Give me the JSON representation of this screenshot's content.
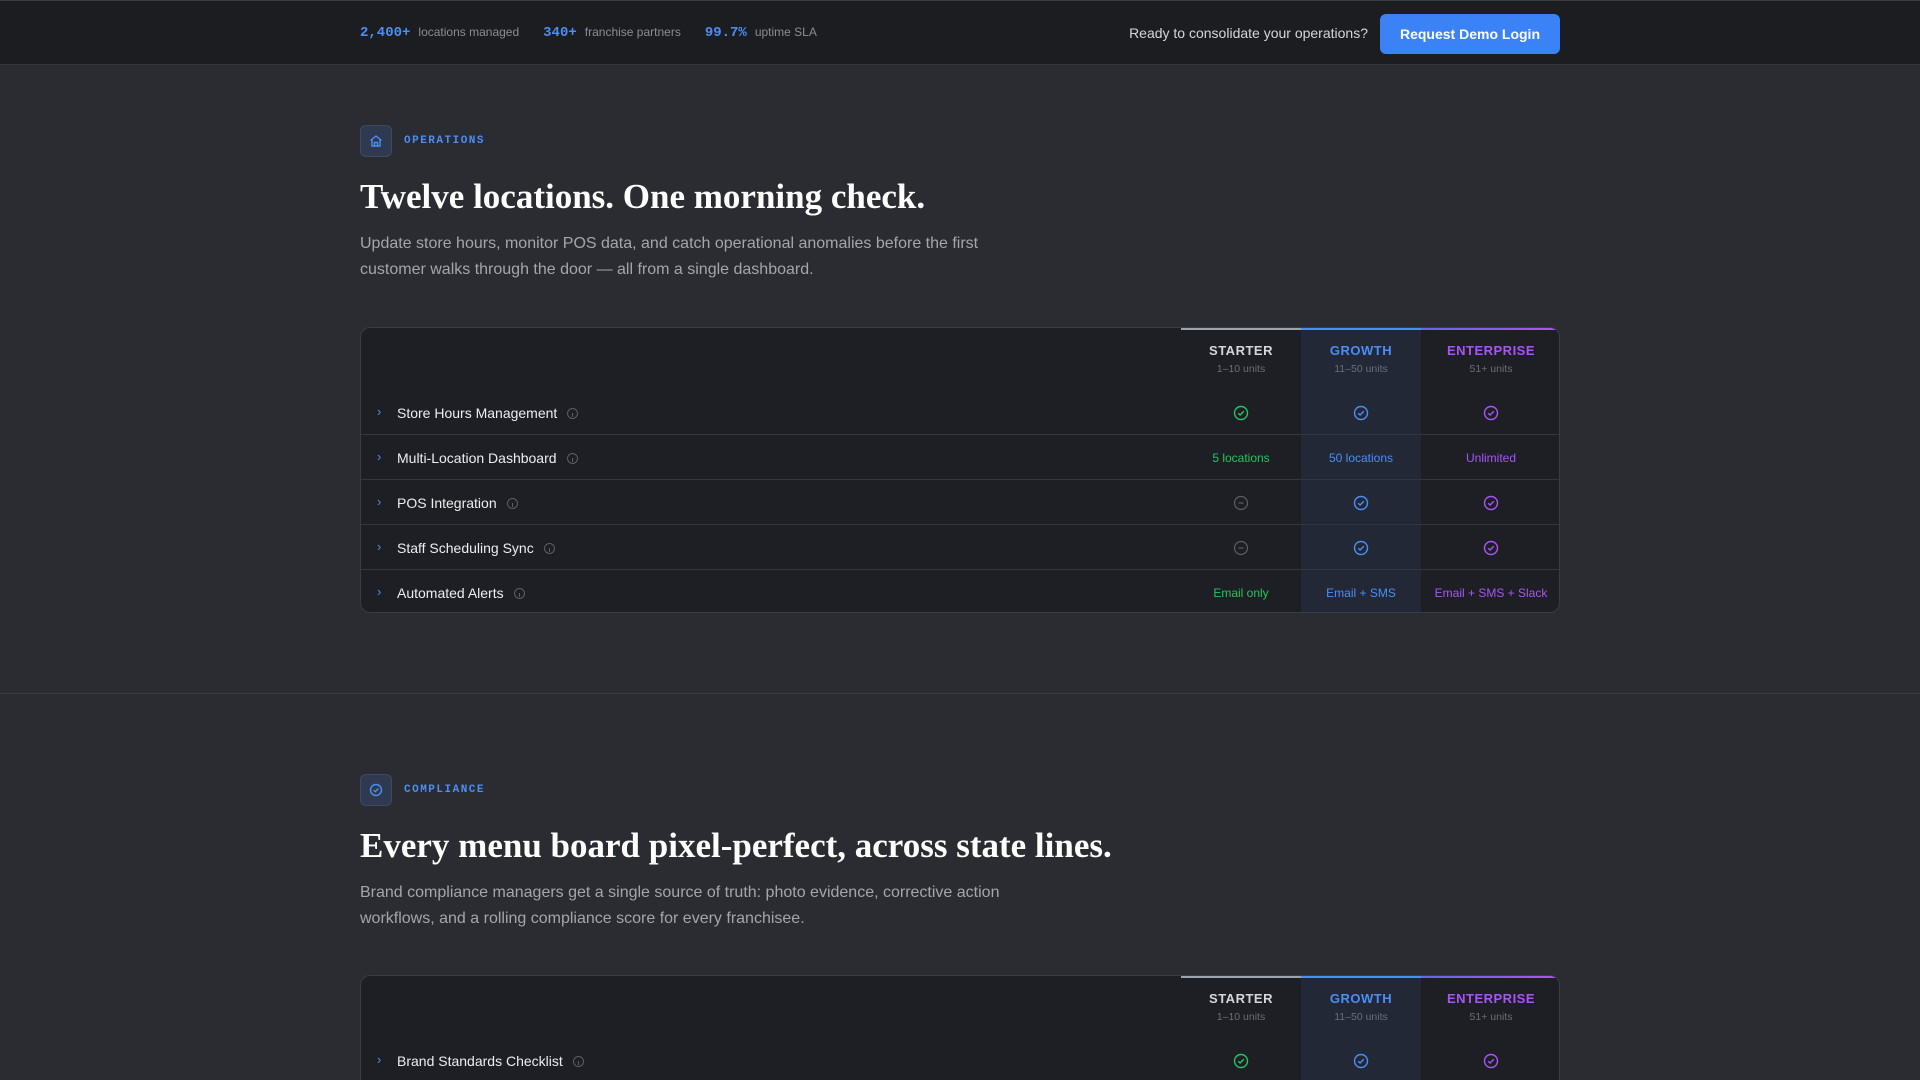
{
  "topbar": {
    "stats": [
      {
        "value": "2,400+",
        "label": "locations managed"
      },
      {
        "value": "340+",
        "label": "franchise partners"
      },
      {
        "value": "99.7%",
        "label": "uptime SLA"
      }
    ],
    "cta_text": "Ready to consolidate your operations?",
    "cta_button": "Request Demo Login"
  },
  "colors": {
    "accent": "#4b8ef5",
    "starter": "#22c55e",
    "growth": "#4b8ef5",
    "enterprise": "#a855f7",
    "na": "#5b5e66"
  },
  "tiers": [
    {
      "name": "STARTER",
      "sub": "1–10 units"
    },
    {
      "name": "GROWTH",
      "sub": "11–50 units"
    },
    {
      "name": "ENTERPRISE",
      "sub": "51+ units"
    }
  ],
  "sections": [
    {
      "tag": "OPERATIONS",
      "icon": "home-icon",
      "headline": "Twelve locations. One morning check.",
      "description": "Update store hours, monitor POS data, and catch operational anomalies before the first customer walks through the door — all from a single dashboard.",
      "rows": [
        {
          "label": "Store Hours Management",
          "starter": "check",
          "growth": "check",
          "enterprise": "check"
        },
        {
          "label": "Multi-Location Dashboard",
          "starter": "5 locations",
          "growth": "50 locations",
          "enterprise": "Unlimited"
        },
        {
          "label": "POS Integration",
          "starter": "none",
          "growth": "check",
          "enterprise": "check"
        },
        {
          "label": "Staff Scheduling Sync",
          "starter": "none",
          "growth": "check",
          "enterprise": "check"
        },
        {
          "label": "Automated Alerts",
          "starter": "Email only",
          "growth": "Email + SMS",
          "enterprise": "Email + SMS + Slack"
        }
      ]
    },
    {
      "tag": "COMPLIANCE",
      "icon": "shield-check-icon",
      "headline": "Every menu board pixel-perfect, across state lines.",
      "description": "Brand compliance managers get a single source of truth: photo evidence, corrective action workflows, and a rolling compliance score for every franchisee.",
      "rows": [
        {
          "label": "Brand Standards Checklist",
          "starter": "check",
          "growth": "check",
          "enterprise": "check"
        }
      ]
    }
  ]
}
